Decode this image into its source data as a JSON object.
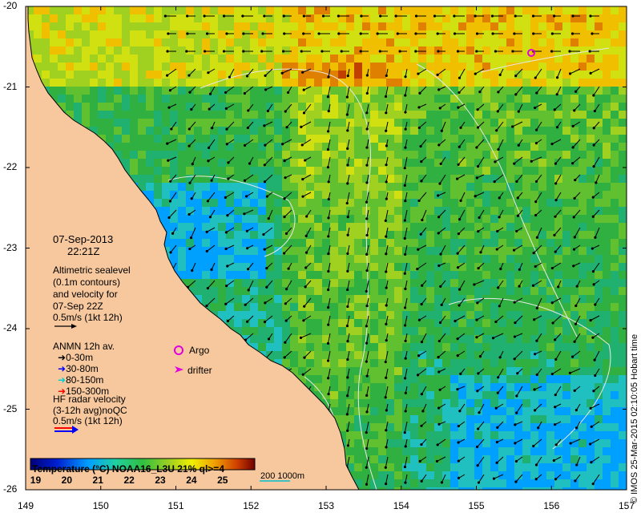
{
  "map": {
    "date": "07-Sep-2013",
    "time": "22:21Z",
    "x_ticks": [
      "149",
      "150",
      "151",
      "152",
      "153",
      "154",
      "155",
      "156",
      "157"
    ],
    "y_ticks": [
      "-20",
      "-21",
      "-22",
      "-23",
      "-24",
      "-25",
      "-26"
    ],
    "lon_range": [
      149,
      157
    ],
    "lat_range": [
      -26,
      -20
    ],
    "credit": "© IMOS 25-Mar-2015 02:10:05 Hobart time",
    "land_color": "#f7c89d",
    "coast_color": "#000000"
  },
  "legend": {
    "altimetry": [
      "Altimetric sealevel",
      "(0.1m contours)",
      "and velocity for",
      "07-Sep 22Z",
      "0.5m/s (1kt 12h)"
    ],
    "anmn_title": "ANMN 12h av.",
    "anmn_items": [
      {
        "label": "0-30m",
        "color": "#000000"
      },
      {
        "label": "30-80m",
        "color": "#0000ff"
      },
      {
        "label": "80-150m",
        "color": "#00e0e0"
      },
      {
        "label": "150-300m",
        "color": "#ff0000"
      }
    ],
    "argo_label": "Argo",
    "drifter_label": "drifter",
    "hf_radar": [
      "HF radar velocity",
      "(3-12h avg)noQC",
      "0.5m/s (1kt 12h)"
    ],
    "temp_title": "Temperature (°C) NOAA16_L3U 21% ql>=4",
    "colorbar_ticks": [
      "19",
      "20",
      "21",
      "22",
      "23",
      "24",
      "25"
    ],
    "colorbar_range": [
      18.8,
      26
    ],
    "contour_label": "200  1000m",
    "argo_color": "#e000e0",
    "contour_color": "#40c0c0"
  }
}
